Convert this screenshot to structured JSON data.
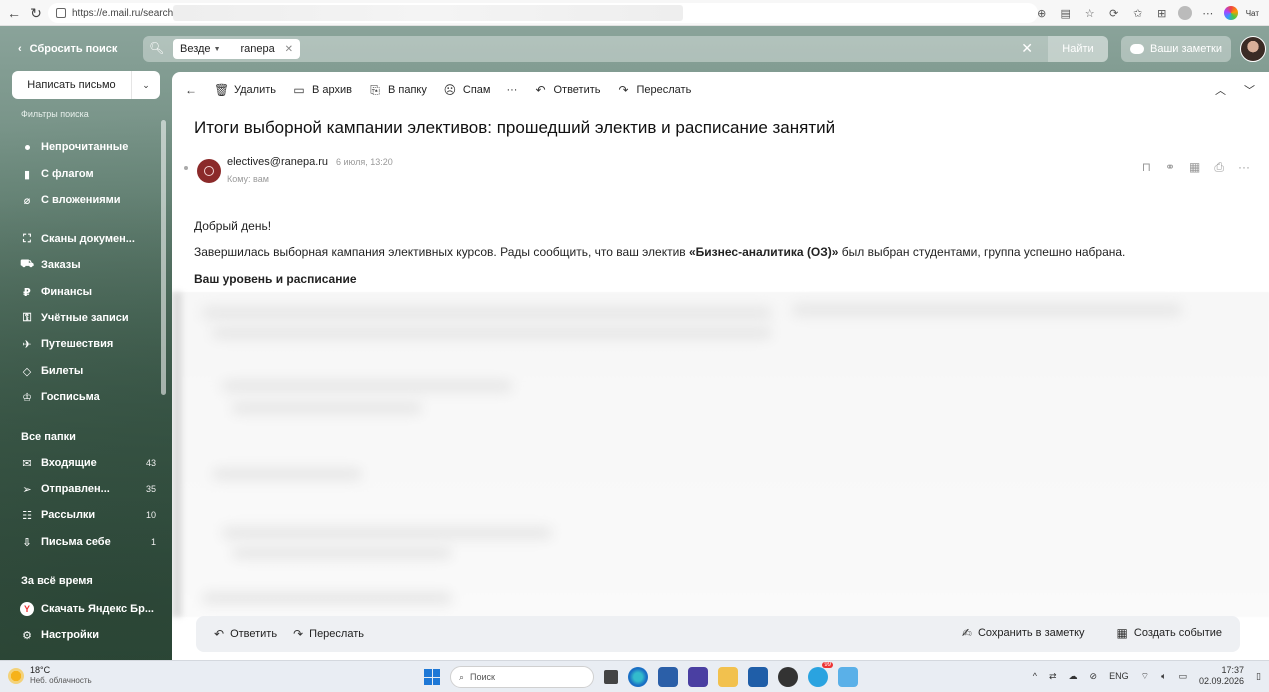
{
  "browser": {
    "url": "https://e.mail.ru/search/in",
    "chat_label": "Чат"
  },
  "top": {
    "reset_search": "Сбросить поиск",
    "search_scope": "Везде",
    "search_query": "ranepa",
    "search_submit": "Найти",
    "notes_button": "Ваши заметки"
  },
  "sidebar": {
    "compose": "Написать письмо",
    "filters_title": "Фильтры поиска",
    "filters": [
      {
        "label": "Непрочитанные",
        "icon": "dot-icon"
      },
      {
        "label": "С флагом",
        "icon": "flag-icon"
      },
      {
        "label": "С вложениями",
        "icon": "paperclip-icon"
      }
    ],
    "categories": [
      {
        "label": "Сканы докумен...",
        "icon": "scan-icon"
      },
      {
        "label": "Заказы",
        "icon": "cart-icon"
      },
      {
        "label": "Финансы",
        "icon": "ruble-icon"
      },
      {
        "label": "Учётные записи",
        "icon": "key-icon"
      },
      {
        "label": "Путешествия",
        "icon": "plane-icon"
      },
      {
        "label": "Билеты",
        "icon": "ticket-icon"
      },
      {
        "label": "Госписьма",
        "icon": "emblem-icon"
      }
    ],
    "all_folders_title": "Все папки",
    "folders": [
      {
        "label": "Входящие",
        "count": "43",
        "icon": "inbox-icon"
      },
      {
        "label": "Отправлен...",
        "count": "35",
        "icon": "sent-icon"
      },
      {
        "label": "Рассылки",
        "count": "10",
        "icon": "newsletter-icon"
      },
      {
        "label": "Письма себе",
        "count": "1",
        "icon": "self-mail-icon"
      }
    ],
    "period_title": "За всё время",
    "extras": [
      {
        "label": "Скачать Яндекс Бр...",
        "icon": "yandex-icon"
      },
      {
        "label": "Настройки",
        "icon": "gear-icon"
      }
    ]
  },
  "toolbar": {
    "delete": "Удалить",
    "archive": "В архив",
    "move": "В папку",
    "spam": "Спам",
    "more": "···",
    "reply": "Ответить",
    "forward": "Переслать"
  },
  "message": {
    "subject": "Итоги выборной кампании элективов: прошедший электив и расписание занятий",
    "sender_email": "electives@ranepa.ru",
    "date": "6 июля, 13:20",
    "to": "Кому: вам",
    "greeting": "Добрый день!",
    "body_prefix": "Завершилась выборная кампания элективных курсов. Рады сообщить, что ваш электив ",
    "body_bold": "«Бизнес-аналитика (ОЗ)»",
    "body_suffix": " был выбран студентами, группа успешно набрана.",
    "section_title": "Ваш уровень и расписание"
  },
  "bottom_bar": {
    "reply": "Ответить",
    "forward": "Переслать",
    "save_note": "Сохранить в заметку",
    "create_event": "Создать событие"
  },
  "taskbar": {
    "temperature": "18°C",
    "weather": "Неб. облачность",
    "search_placeholder": "Поиск",
    "lang": "ENG",
    "time": "17:37",
    "date": "02.09.2026",
    "badge": "99"
  },
  "colors": {
    "accent_blue": "#1e78d6",
    "sender_avatar": "#8b2a2a"
  }
}
